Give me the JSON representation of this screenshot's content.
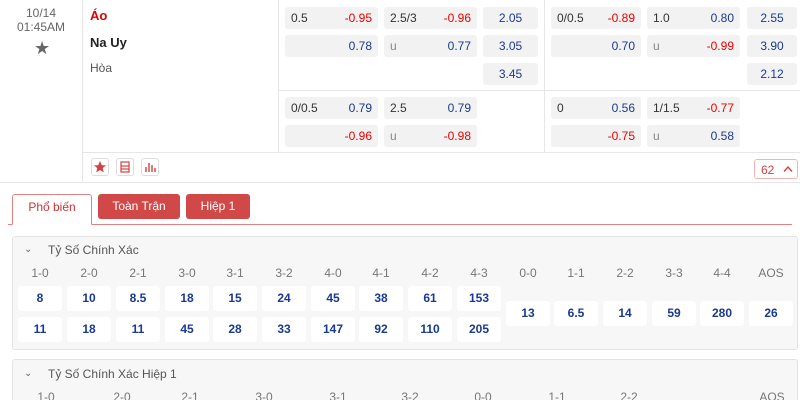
{
  "match": {
    "date": "10/14",
    "time": "01:45AM",
    "home": "Áo",
    "away": "Na Uy",
    "draw": "Hòa",
    "more_count": "62",
    "colors": {
      "home_team": "#e00000",
      "negative": "#e00000",
      "positive": "#1a3a8f",
      "accent": "#d04848"
    }
  },
  "odds": {
    "ft_handicap": {
      "line": "0.5",
      "home": "-0.95",
      "away": "0.78"
    },
    "ft_ou": {
      "line": "2.5/3",
      "over": "-0.96",
      "under_label": "u",
      "under": "0.77"
    },
    "ft_1x2": [
      "2.05",
      "3.05",
      "3.45"
    ],
    "h1_handicap": {
      "line": "0/0.5",
      "home": "-0.89",
      "away": "0.70"
    },
    "h1_ou": {
      "line": "1.0",
      "over": "0.80",
      "under_label": "u",
      "under": "-0.99"
    },
    "h1_1x2": [
      "2.55",
      "3.90",
      "2.12"
    ],
    "ft_handicap_2": {
      "line": "0/0.5",
      "home": "0.79",
      "away": "-0.96"
    },
    "ft_ou_2": {
      "line": "2.5",
      "over": "0.79",
      "under_label": "u",
      "under": "-0.98"
    },
    "h1_handicap_2": {
      "line": "0",
      "home": "0.56",
      "away": "-0.75"
    },
    "h1_ou_2": {
      "line": "1/1.5",
      "over": "-0.77",
      "under_label": "u",
      "under": "0.58"
    }
  },
  "tabs": [
    "Phổ biến",
    "Toàn Trận",
    "Hiệp 1"
  ],
  "correct_score": {
    "title": "Tỷ Số Chính Xác",
    "home_labels": [
      "1-0",
      "2-0",
      "2-1",
      "3-0",
      "3-1",
      "3-2",
      "4-0",
      "4-1",
      "4-2",
      "4-3"
    ],
    "home_values": [
      "8",
      "10",
      "8.5",
      "18",
      "15",
      "24",
      "45",
      "38",
      "61",
      "153"
    ],
    "away_values": [
      "11",
      "18",
      "11",
      "45",
      "28",
      "33",
      "147",
      "92",
      "110",
      "205"
    ],
    "draw_labels": [
      "0-0",
      "1-1",
      "2-2",
      "3-3",
      "4-4",
      "AOS"
    ],
    "draw_values": [
      "13",
      "6.5",
      "14",
      "59",
      "280",
      "26"
    ]
  },
  "correct_score_h1": {
    "title": "Tỷ Số Chính Xác Hiệp 1",
    "labels": [
      "1-0",
      "2-0",
      "2-1",
      "3-0",
      "3-1",
      "3-2",
      "0-0",
      "1-1",
      "2-2",
      "AOS"
    ]
  }
}
